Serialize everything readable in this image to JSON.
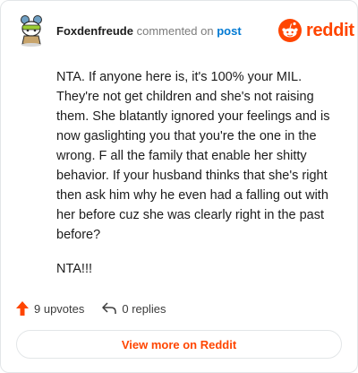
{
  "comment": {
    "author": "Foxdenfreude",
    "action": "commented on",
    "post_link": "post",
    "avatar_icon": "snoo-avatar-icon",
    "paragraphs": [
      "NTA. If anyone here is, it's 100% your MIL. They're not get children and she's not raising them. She blatantly ignored your feelings and is now gaslighting you that you're the one in the wrong. F all the family that enable her shitty behavior. If your husband thinks that she's right then ask him why he even had a falling out with her before cuz she was clearly right in the past before?",
      "NTA!!!"
    ]
  },
  "brand": {
    "name": "reddit",
    "icon": "reddit-logo-icon",
    "color": "#ff4500"
  },
  "footer": {
    "upvotes": "9 upvotes",
    "upvote_icon": "upvote-arrow-icon",
    "replies": "0 replies",
    "reply_icon": "reply-arrow-icon"
  },
  "view_more": {
    "label": "View more on Reddit"
  },
  "colors": {
    "accent": "#ff4500",
    "link": "#0079d3",
    "muted": "#7c7c7c",
    "border": "#e3e6e8"
  }
}
